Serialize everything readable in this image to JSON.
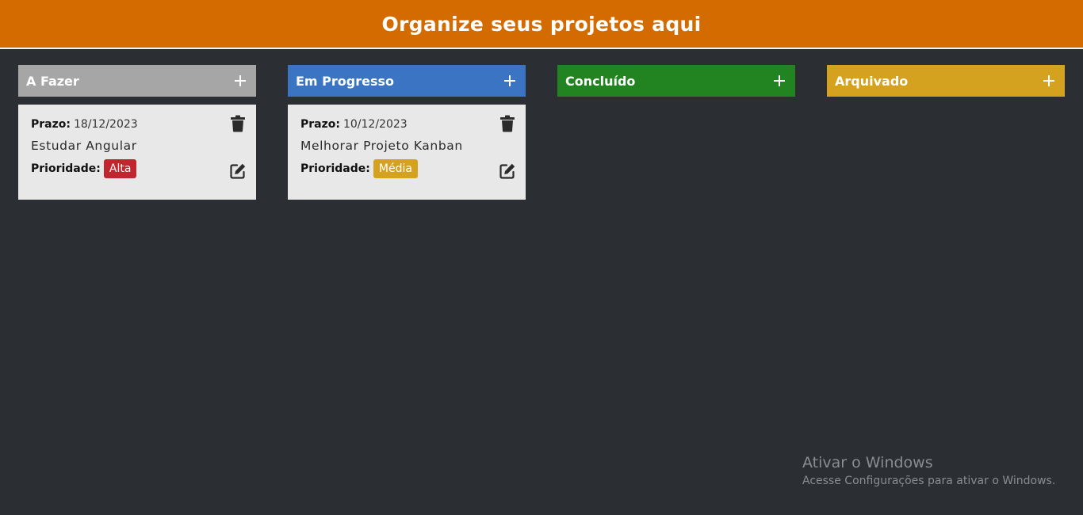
{
  "header": {
    "title": "Organize seus projetos aqui"
  },
  "colors": {
    "header_bg": "#d46b00",
    "page_bg": "#2b2e33",
    "card_bg": "#e8e8e8",
    "priority_high": "#c0262d",
    "priority_medium": "#d4a21e"
  },
  "columns": [
    {
      "title": "A Fazer",
      "color": "#a6a6a6",
      "cards": [
        {
          "deadline_label": "Prazo:",
          "deadline": "18/12/2023",
          "text": "Estudar Angular",
          "priority_label": "Prioridade:",
          "priority": "Alta",
          "priority_color": "#c0262d"
        }
      ]
    },
    {
      "title": "Em Progresso",
      "color": "#3a74c2",
      "cards": [
        {
          "deadline_label": "Prazo:",
          "deadline": "10/12/2023",
          "text": "Melhorar Projeto Kanban",
          "priority_label": "Prioridade:",
          "priority": "Média",
          "priority_color": "#d4a21e"
        }
      ]
    },
    {
      "title": "Concluído",
      "color": "#228421",
      "cards": []
    },
    {
      "title": "Arquivado",
      "color": "#d4a21e",
      "cards": []
    }
  ],
  "watermark": {
    "title": "Ativar o Windows",
    "subtitle": "Acesse Configurações para ativar o Windows."
  }
}
